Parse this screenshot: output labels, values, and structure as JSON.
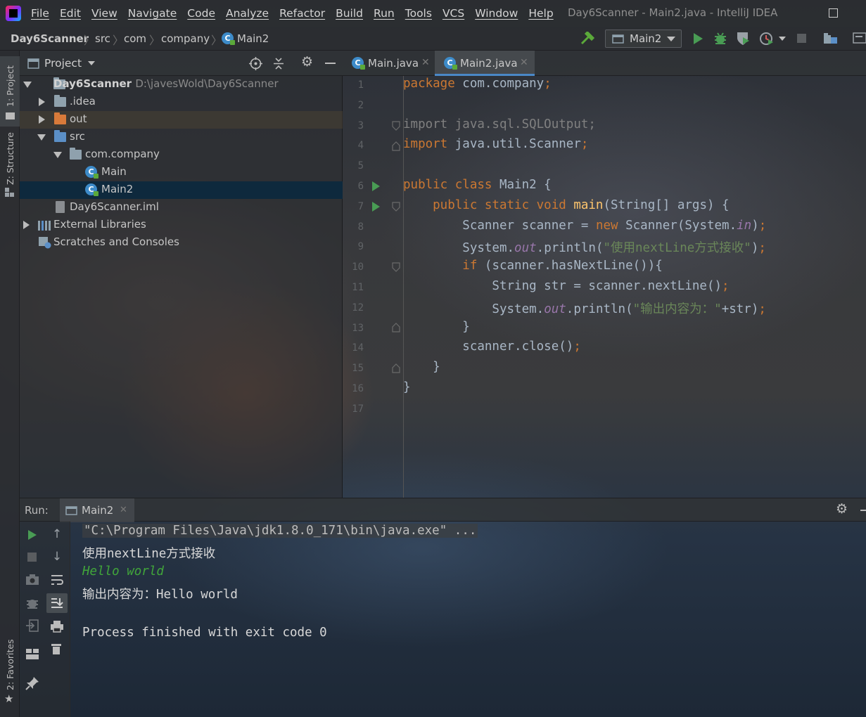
{
  "window": {
    "title": "Day6Scanner - Main2.java - IntelliJ IDEA"
  },
  "menu": [
    "File",
    "Edit",
    "View",
    "Navigate",
    "Code",
    "Analyze",
    "Refactor",
    "Build",
    "Run",
    "Tools",
    "VCS",
    "Window",
    "Help"
  ],
  "breadcrumb": [
    "Day6Scanner",
    "src",
    "com",
    "company",
    "Main2"
  ],
  "run_config": {
    "selected": "Main2"
  },
  "left_tool_tabs": {
    "project": "1: Project",
    "structure": "Z: Structure",
    "favorites": "2: Favorites"
  },
  "project_panel": {
    "title": "Project",
    "tree": [
      {
        "label": "Day6Scanner",
        "path": "D:\\javesWold\\Day6Scanner"
      },
      {
        "label": ".idea"
      },
      {
        "label": "out"
      },
      {
        "label": "src"
      },
      {
        "label": "com.company"
      },
      {
        "label": "Main"
      },
      {
        "label": "Main2"
      },
      {
        "label": "Day6Scanner.iml"
      },
      {
        "label": "External Libraries"
      },
      {
        "label": "Scratches and Consoles"
      }
    ]
  },
  "editor_tabs": [
    {
      "label": "Main.java",
      "active": false
    },
    {
      "label": "Main2.java",
      "active": true
    }
  ],
  "editor": {
    "line_numbers": [
      "1",
      "2",
      "3",
      "4",
      "5",
      "6",
      "7",
      "8",
      "9",
      "10",
      "11",
      "12",
      "13",
      "14",
      "15",
      "16",
      "17"
    ],
    "code": [
      {
        "s": [
          {
            "t": "package ",
            "c": "kw"
          },
          {
            "t": "com.company",
            "c": ""
          },
          {
            "t": ";",
            "c": "kw"
          }
        ]
      },
      {
        "s": []
      },
      {
        "s": [
          {
            "t": "import java.sql.SQLOutput;",
            "c": "imp"
          }
        ]
      },
      {
        "s": [
          {
            "t": "import ",
            "c": "kw"
          },
          {
            "t": "java.util.Scanner",
            "c": ""
          },
          {
            "t": ";",
            "c": "kw"
          }
        ]
      },
      {
        "s": []
      },
      {
        "s": [
          {
            "t": "public class ",
            "c": "kw"
          },
          {
            "t": "Main2 {",
            "c": ""
          }
        ]
      },
      {
        "s": [
          {
            "t": "    public static void ",
            "c": "kw"
          },
          {
            "t": "main",
            "c": "fn"
          },
          {
            "t": "(String[] args) {",
            "c": ""
          }
        ]
      },
      {
        "s": [
          {
            "t": "        Scanner scanner = ",
            "c": ""
          },
          {
            "t": "new ",
            "c": "kw"
          },
          {
            "t": "Scanner(System.",
            "c": ""
          },
          {
            "t": "in",
            "c": "fld"
          },
          {
            "t": ")",
            "c": ""
          },
          {
            "t": ";",
            "c": "kw"
          }
        ]
      },
      {
        "s": [
          {
            "t": "        System.",
            "c": ""
          },
          {
            "t": "out",
            "c": "fld"
          },
          {
            "t": ".println(",
            "c": ""
          },
          {
            "t": "\"使用nextLine方式接收\"",
            "c": "str"
          },
          {
            "t": ")",
            "c": ""
          },
          {
            "t": ";",
            "c": "kw"
          }
        ]
      },
      {
        "s": [
          {
            "t": "        if ",
            "c": "kw"
          },
          {
            "t": "(scanner.hasNextLine()){",
            "c": ""
          }
        ]
      },
      {
        "s": [
          {
            "t": "            String str = scanner.nextLine()",
            "c": ""
          },
          {
            "t": ";",
            "c": "kw"
          }
        ]
      },
      {
        "s": [
          {
            "t": "            System.",
            "c": ""
          },
          {
            "t": "out",
            "c": "fld"
          },
          {
            "t": ".println(",
            "c": ""
          },
          {
            "t": "\"输出内容为：\"",
            "c": "str"
          },
          {
            "t": "+str)",
            "c": ""
          },
          {
            "t": ";",
            "c": "kw"
          }
        ]
      },
      {
        "s": [
          {
            "t": "        }",
            "c": ""
          }
        ]
      },
      {
        "s": [
          {
            "t": "        scanner.close()",
            "c": ""
          },
          {
            "t": ";",
            "c": "kw"
          }
        ]
      },
      {
        "s": [
          {
            "t": "    }",
            "c": ""
          }
        ]
      },
      {
        "s": [
          {
            "t": "}",
            "c": ""
          }
        ]
      },
      {
        "s": []
      }
    ]
  },
  "run_panel": {
    "label": "Run:",
    "tab": "Main2",
    "console": [
      "\"C:\\Program Files\\Java\\jdk1.8.0_171\\bin\\java.exe\" ...",
      "使用nextLine方式接收",
      "Hello world",
      "输出内容为：Hello world",
      "",
      "Process finished with exit code 0"
    ]
  },
  "colors": {
    "keyword": "#cc7832",
    "method": "#ffc66d",
    "string": "#6a8759",
    "field": "#9876aa",
    "run_green": "#499c54",
    "selection": "#0d293e",
    "tab_underline": "#4a88c7"
  }
}
